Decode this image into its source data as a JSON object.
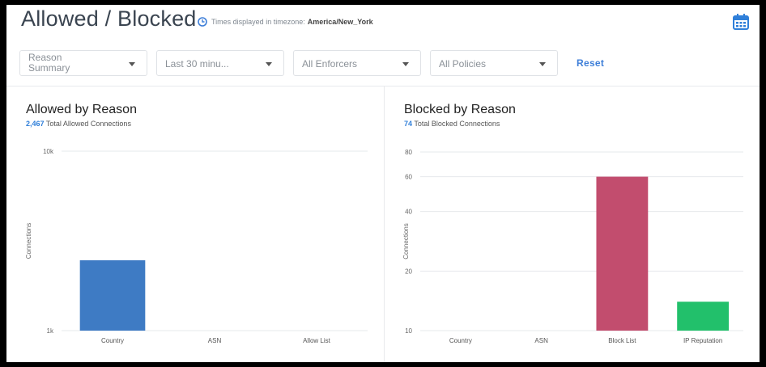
{
  "header": {
    "title": "Allowed / Blocked",
    "timezone_label": "Times displayed in timezone:",
    "timezone_value": "America/New_York"
  },
  "filters": {
    "reason": "Reason Summary",
    "time_range": "Last 30 minu...",
    "enforcers": "All Enforcers",
    "policies": "All Policies",
    "reset_label": "Reset"
  },
  "colors": {
    "accent": "#3d7ed8",
    "allowed_bar": "#3e7bc4",
    "blocked_bar": "#c24d6e",
    "reputation_bar": "#22c06b"
  },
  "icons": {
    "clock": "clock-icon",
    "calendar": "calendar-icon"
  },
  "allowed": {
    "title": "Allowed by Reason",
    "total": "2,467",
    "total_label": "Total Allowed Connections"
  },
  "blocked": {
    "title": "Blocked by Reason",
    "total": "74",
    "total_label": "Total Blocked Connections"
  },
  "chart_data": [
    {
      "type": "bar",
      "title": "Allowed by Reason",
      "ylabel": "Connections",
      "yscale": "log",
      "yticks": [
        "1k",
        "10k"
      ],
      "ylim": [
        1000,
        10000
      ],
      "categories": [
        "Country",
        "ASN",
        "Allow List"
      ],
      "values": [
        2467,
        0,
        0
      ],
      "colors": [
        "#3e7bc4",
        "#3e7bc4",
        "#3e7bc4"
      ]
    },
    {
      "type": "bar",
      "title": "Blocked by Reason",
      "ylabel": "Connections",
      "yscale": "log",
      "yticks": [
        "10",
        "20",
        "40",
        "60",
        "80"
      ],
      "ylim": [
        10,
        80
      ],
      "categories": [
        "Country",
        "ASN",
        "Block List",
        "IP Reputation"
      ],
      "values": [
        0,
        0,
        60,
        14
      ],
      "colors": [
        "#c24d6e",
        "#c24d6e",
        "#c24d6e",
        "#22c06b"
      ]
    }
  ]
}
